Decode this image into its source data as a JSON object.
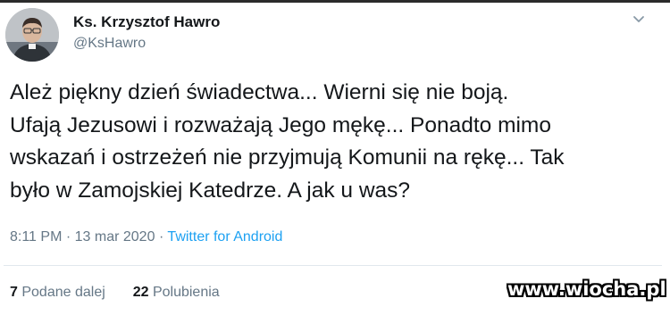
{
  "author": {
    "name": "Ks. Krzysztof Hawro",
    "handle": "@KsHawro"
  },
  "tweet": {
    "lines": [
      "Ależ piękny dzień świadectwa... Wierni się nie boją.",
      "Ufają Jezusowi i rozważają Jego mękę... Ponadto mimo",
      "wskazań i ostrzeżeń nie przyjmują Komunii na rękę... Tak",
      "było w Zamojskiej Katedrze. A jak u was?"
    ]
  },
  "meta": {
    "time": "8:11 PM",
    "separator": "·",
    "date": "13 mar 2020",
    "source": "Twitter for Android"
  },
  "stats": {
    "retweets_count": "7",
    "retweets_label": "Podane dalej",
    "likes_count": "22",
    "likes_label": "Polubienia"
  },
  "watermark": "www.wiocha.pl",
  "icons": {
    "menu": "chevron-down-icon",
    "avatar": "profile-photo"
  },
  "colors": {
    "text": "#14171a",
    "secondary": "#657786",
    "link": "#1da1f2",
    "divider": "#e1e8ed"
  }
}
